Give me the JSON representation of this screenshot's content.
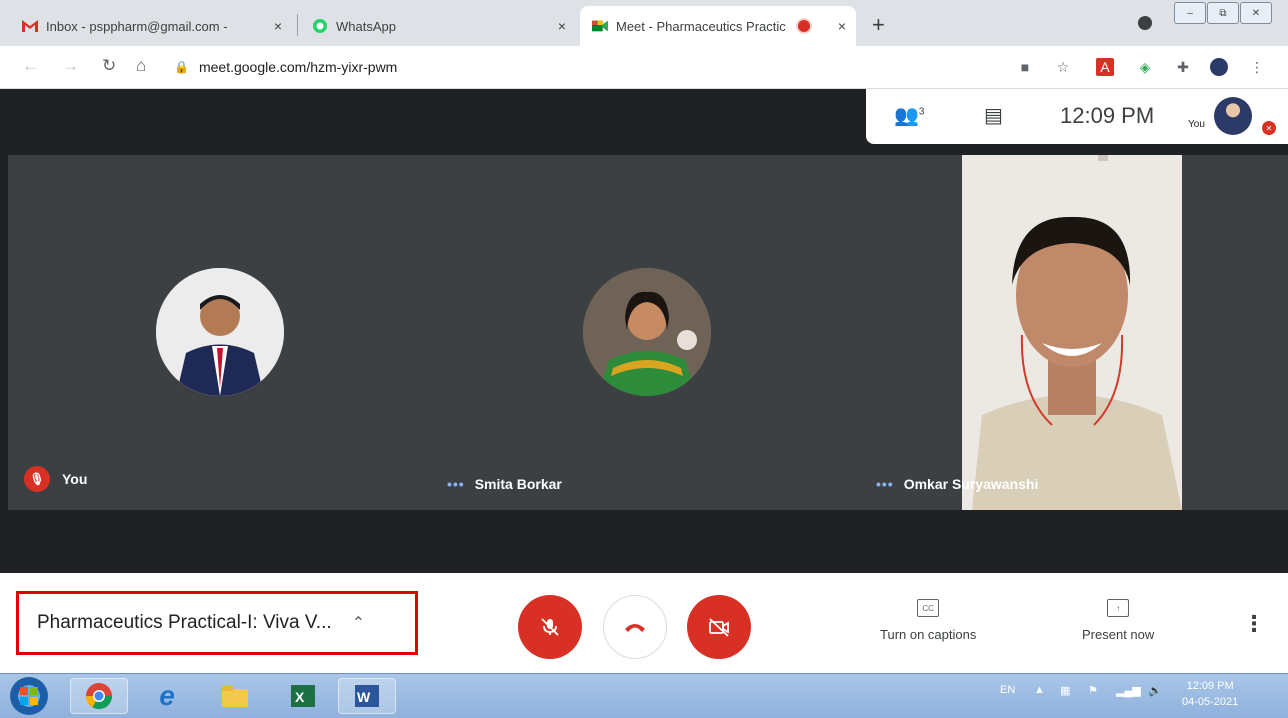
{
  "browser": {
    "tabs": [
      {
        "title": "Inbox - psppharm@gmail.com - ",
        "icon": "gmail-icon"
      },
      {
        "title": "WhatsApp",
        "icon": "whatsapp-icon"
      },
      {
        "title": "Meet - Pharmaceutics Practic",
        "icon": "meet-icon",
        "active": true
      }
    ],
    "close_glyph": "×",
    "new_tab": "+",
    "url": "meet.google.com/hzm-yixr-pwm",
    "window_buttons": {
      "minimize": "–",
      "restore": "⧉",
      "close": "✕"
    }
  },
  "meet": {
    "participants_count": "3",
    "clock": "12:09 PM",
    "you_label": "You",
    "tiles": [
      {
        "name": "You",
        "muted": true
      },
      {
        "name": "Smita Borkar",
        "muted": false
      },
      {
        "name": "Omkar Suryawanshi",
        "muted": false
      }
    ],
    "meeting_title": "Pharmaceutics Practical-I: Viva V...",
    "captions_label": "Turn on captions",
    "captions_icon_text": "CC",
    "present_label": "Present now",
    "more_glyph": "⋮"
  },
  "taskbar": {
    "lang": "EN",
    "time": "12:09 PM",
    "date": "04-05-2021"
  },
  "colors": {
    "meet_red": "#d93025",
    "meet_bg": "#202124",
    "tile_bg": "#3c4043",
    "highlight": "#e00000"
  }
}
